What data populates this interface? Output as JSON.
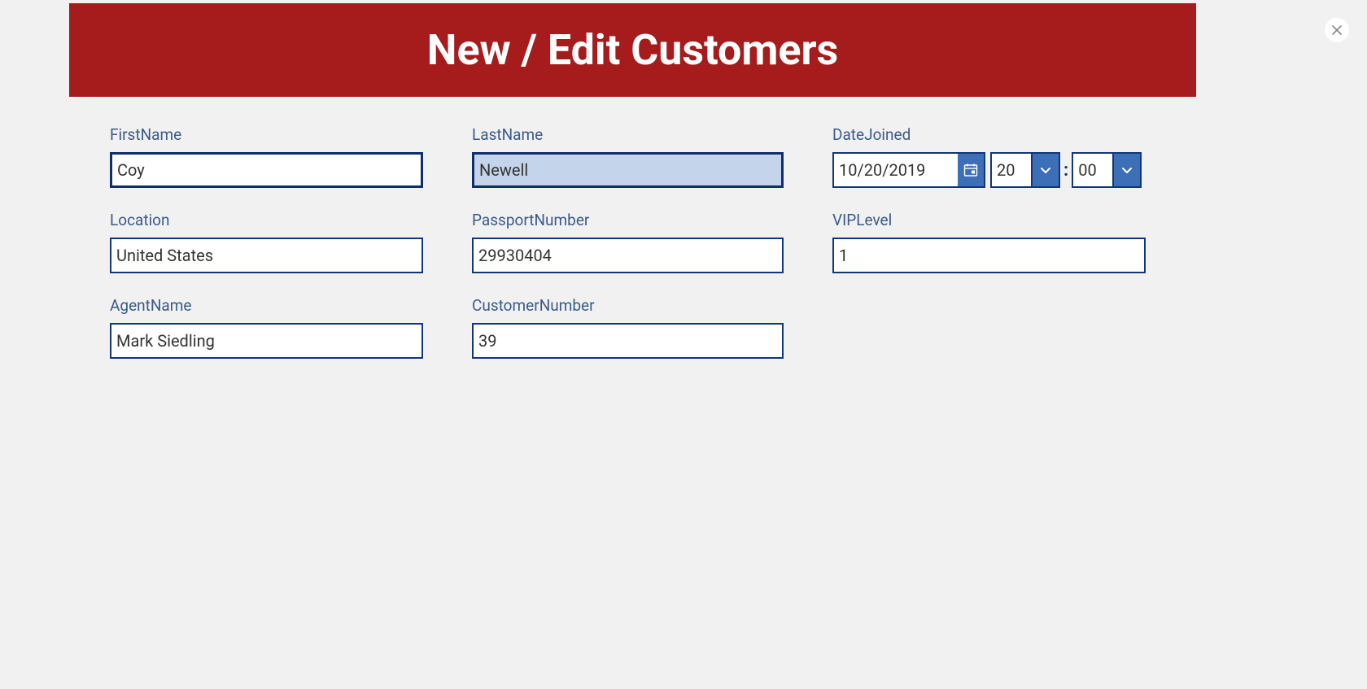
{
  "header": {
    "title": "New / Edit Customers"
  },
  "fields": {
    "firstName": {
      "label": "FirstName",
      "value": "Coy"
    },
    "lastName": {
      "label": "LastName",
      "value": "Newell"
    },
    "dateJoined": {
      "label": "DateJoined",
      "date": "10/20/2019",
      "hour": "20",
      "minute": "00"
    },
    "location": {
      "label": "Location",
      "value": "United States"
    },
    "passportNumber": {
      "label": "PassportNumber",
      "value": "29930404"
    },
    "vipLevel": {
      "label": "VIPLevel",
      "value": "1"
    },
    "agentName": {
      "label": "AgentName",
      "value": "Mark Siedling"
    },
    "customerNumber": {
      "label": "CustomerNumber",
      "value": "39"
    }
  },
  "colors": {
    "headerBg": "#a61c1c",
    "labelText": "#3a5a8a",
    "border": "#13357b",
    "buttonBg": "#3c6fb5",
    "highlight": "#c4d4eb"
  }
}
